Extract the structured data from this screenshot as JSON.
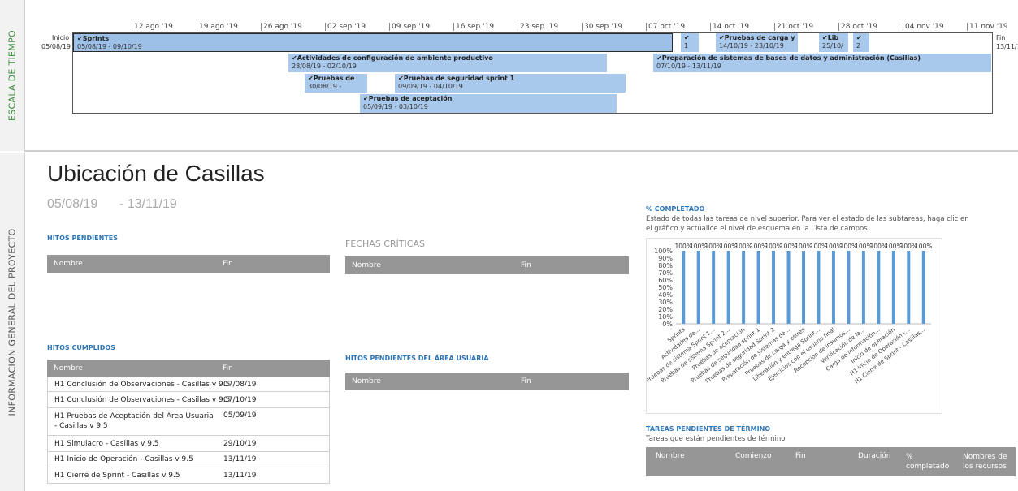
{
  "rails": {
    "timeline_label": "ESCALA DE TIEMPO",
    "project_label": "INFORMACIÓN GENERAL DEL PROYECTO"
  },
  "timeline": {
    "start_label": "Inicio",
    "start_date": "05/08/19",
    "end_label": "Fin",
    "end_date": "13/11/1",
    "ticks": [
      "12 ago '19",
      "19 ago '19",
      "26 ago '19",
      "02 sep '19",
      "09 sep '19",
      "16 sep '19",
      "23 sep '19",
      "30 sep '19",
      "07 oct '19",
      "14 oct '19",
      "21 oct '19",
      "28 oct '19",
      "04 nov '19",
      "11 nov '19"
    ],
    "tasks": [
      {
        "name": "Sprints",
        "dates": "05/08/19 - 09/10/19"
      },
      {
        "name": "",
        "dates": "1"
      },
      {
        "name": "Pruebas de carga y",
        "dates": "14/10/19 - 23/10/19"
      },
      {
        "name": "Lib",
        "dates": "25/10/"
      },
      {
        "name": "",
        "dates": "2"
      },
      {
        "name": "Actividades de configuración de ambiente productivo",
        "dates": "28/08/19 - 02/10/19"
      },
      {
        "name": "Preparación de sistemas de bases de datos y administración (Casillas)",
        "dates": "07/10/19 - 13/11/19"
      },
      {
        "name": "Pruebas de",
        "dates": "30/08/19 -"
      },
      {
        "name": "Pruebas de seguridad sprint 1",
        "dates": "09/09/19 - 04/10/19"
      },
      {
        "name": "Pruebas de aceptación",
        "dates": "05/09/19 - 03/10/19"
      }
    ],
    "check": "✔"
  },
  "project": {
    "title": "Ubicación de Casillas",
    "start": "05/08/19",
    "separator": "-",
    "end": "13/11/19"
  },
  "hitos_pendientes": {
    "heading": "HITOS PENDIENTES",
    "col_name": "Nombre",
    "col_end": "Fin"
  },
  "fechas_criticas": {
    "heading": "FECHAS CRÍTICAS",
    "col_name": "Nombre",
    "col_end": "Fin"
  },
  "hitos_cumplidos": {
    "heading": "HITOS CUMPLIDOS",
    "col_name": "Nombre",
    "col_end": "Fin",
    "rows": [
      {
        "name": "H1 Conclusión de Observaciones - Casillas v 9.5",
        "end": "07/08/19"
      },
      {
        "name": "H1 Conclusión de Observaciones - Casillas v 9.5",
        "end": "07/10/19"
      },
      {
        "name": "H1 Pruebas de Aceptación del Area Usuaria - Casillas v 9.5",
        "end": "05/09/19"
      },
      {
        "name": "H1 Simulacro - Casillas v 9.5",
        "end": "29/10/19"
      },
      {
        "name": "H1 Inicio de Operación - Casillas v 9.5",
        "end": "13/11/19"
      },
      {
        "name": "H1 Cierre de Sprint - Casillas v 9.5",
        "end": "13/11/19"
      }
    ]
  },
  "hitos_usuaria": {
    "heading": "HITOS PENDIENTES DEL ÁREA USUARIA",
    "col_name": "Nombre",
    "col_end": "Fin"
  },
  "completado": {
    "heading": "% COMPLETADO",
    "description": "Estado de todas las tareas de nivel superior. Para ver el estado de las subtareas, haga clic en el gráfico y actualice el nivel de esquema en la Lista de campos."
  },
  "tareas_pendientes": {
    "heading": "TAREAS PENDIENTES DE TÉRMINO",
    "description": "Tareas que están pendientes de término.",
    "cols": [
      "Nombre",
      "Comienzo",
      "Fin",
      "Duración",
      "% completado",
      "Nombres de los recursos"
    ]
  },
  "chart_data": {
    "type": "bar",
    "categories": [
      "Sprints",
      "Actividades de...",
      "Pruebas de sistema Sprint 1...",
      "Pruebas de sistema Sprint 2...",
      "Pruebas de aceptación",
      "Pruebas de seguridad sprint 1",
      "Pruebas de seguridad Sprint 2",
      "Preparación de sistemas de...",
      "Pruebas de carga y estrés",
      "Liberación y entrega Sprint...",
      "Ejercicios con el usuario final",
      "Recepción de insumos...",
      "Verificación de la...",
      "Carga de información...",
      "Inicio de operación",
      "H1 Inicio de Operación -...",
      "H1 Cierre de Sprint - Casillas..."
    ],
    "values": [
      100,
      100,
      100,
      100,
      100,
      100,
      100,
      100,
      100,
      100,
      100,
      100,
      100,
      100,
      100,
      100,
      100
    ],
    "value_labels": [
      "100%",
      "100%",
      "100%",
      "100%",
      "100%",
      "100%",
      "100%",
      "100%",
      "100%",
      "100%",
      "100%",
      "100%",
      "100%",
      "100%",
      "100%",
      "100%",
      "100%"
    ],
    "yticks": [
      "0%",
      "10%",
      "20%",
      "30%",
      "40%",
      "50%",
      "60%",
      "70%",
      "80%",
      "90%",
      "100%"
    ],
    "ylim": [
      0,
      100
    ],
    "bar_color": "#5b9bd5",
    "grid": false
  }
}
